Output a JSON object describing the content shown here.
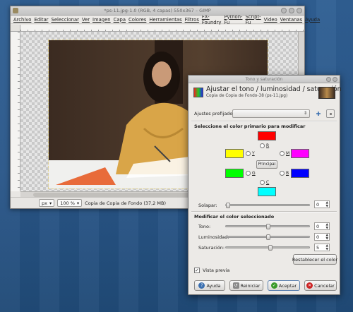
{
  "gimp": {
    "title": "*ps-11.jpg-1.0 (RGB, 4 capas) 550x367 – GIMP",
    "menu": [
      "Archivo",
      "Editar",
      "Seleccionar",
      "Ver",
      "Imagen",
      "Capa",
      "Colores",
      "Herramientas",
      "Filtros",
      "FX-Foundry",
      "Python-Fu",
      "Script-Fu",
      "Video",
      "Ventanas",
      "Ayuda"
    ],
    "status": {
      "unit": "px",
      "zoom": "100 %",
      "layer_info": "Copia de Copia de Fondo (37,2 MB)"
    }
  },
  "dialog": {
    "window_title": "Tono y saturación",
    "header_title": "Ajustar el tono / luminosidad / saturación",
    "header_subtitle": "Copia de Copia de Fondo-38 (ps-11.jpg)",
    "presets_label": "Ajustes prefijados:",
    "primary_heading": "Seleccione el color primario para modificar",
    "colors": {
      "R": "#ff0000",
      "Y": "#ffff00",
      "G": "#00ff00",
      "C": "#00ffff",
      "B": "#0000ff",
      "M": "#ff00ff"
    },
    "radio_labels": {
      "R": "R",
      "Y": "Y",
      "G": "G",
      "C": "C",
      "B": "B",
      "M": "M"
    },
    "principal_label": "Principal",
    "overlap": {
      "label": "Solapar:",
      "value": "0",
      "fraction": 0.0
    },
    "modify_heading": "Modificar el color seleccionado",
    "sliders": [
      {
        "label": "Tono:",
        "value": "0",
        "fraction": 0.5
      },
      {
        "label": "Luminosidad:",
        "value": "0",
        "fraction": 0.5
      },
      {
        "label": "Saturación:",
        "value": "5",
        "fraction": 0.52
      }
    ],
    "reset_color_label": "Restablecer el color",
    "preview_label": "Vista previa",
    "preview_checked": true,
    "buttons": {
      "help": "Ayuda",
      "reset": "Reiniciar",
      "ok": "Aceptar",
      "cancel": "Cancelar"
    }
  }
}
